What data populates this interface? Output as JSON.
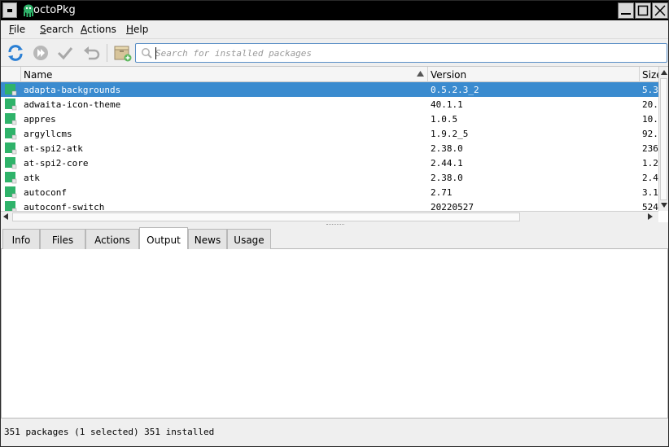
{
  "window": {
    "title": "octoPkg"
  },
  "menubar": {
    "items": [
      "File",
      "Search",
      "Actions",
      "Help"
    ]
  },
  "toolbar": {
    "buttons": [
      "sync-database",
      "system-upgrade",
      "commit",
      "rollback",
      "package-manager"
    ],
    "search_placeholder": "Search for installed packages",
    "search_value": ""
  },
  "table": {
    "columns": [
      "Name",
      "Version",
      "Size"
    ],
    "rows": [
      {
        "name": "adapta-backgrounds",
        "version": "0.5.2.3_2",
        "size": "5.3",
        "selected": true
      },
      {
        "name": "adwaita-icon-theme",
        "version": "40.1.1",
        "size": "20."
      },
      {
        "name": "appres",
        "version": "1.0.5",
        "size": "10."
      },
      {
        "name": "argyllcms",
        "version": "1.9.2_5",
        "size": "92."
      },
      {
        "name": "at-spi2-atk",
        "version": "2.38.0",
        "size": "236"
      },
      {
        "name": "at-spi2-core",
        "version": "2.44.1",
        "size": "1.2"
      },
      {
        "name": "atk",
        "version": "2.38.0",
        "size": "2.4"
      },
      {
        "name": "autoconf",
        "version": "2.71",
        "size": "3.1"
      },
      {
        "name": "autoconf-switch",
        "version": "20220527",
        "size": "524"
      }
    ]
  },
  "tabs": [
    {
      "label": "Info"
    },
    {
      "label": "Files"
    },
    {
      "label": "Actions"
    },
    {
      "label": "Output",
      "active": true
    },
    {
      "label": "News"
    },
    {
      "label": "Usage"
    }
  ],
  "status": {
    "text": "351 packages (1 selected)  351 installed"
  },
  "colors": {
    "selection": "#3a8bcf",
    "titlebar": "#000000",
    "accent_green": "#2fb36a"
  }
}
